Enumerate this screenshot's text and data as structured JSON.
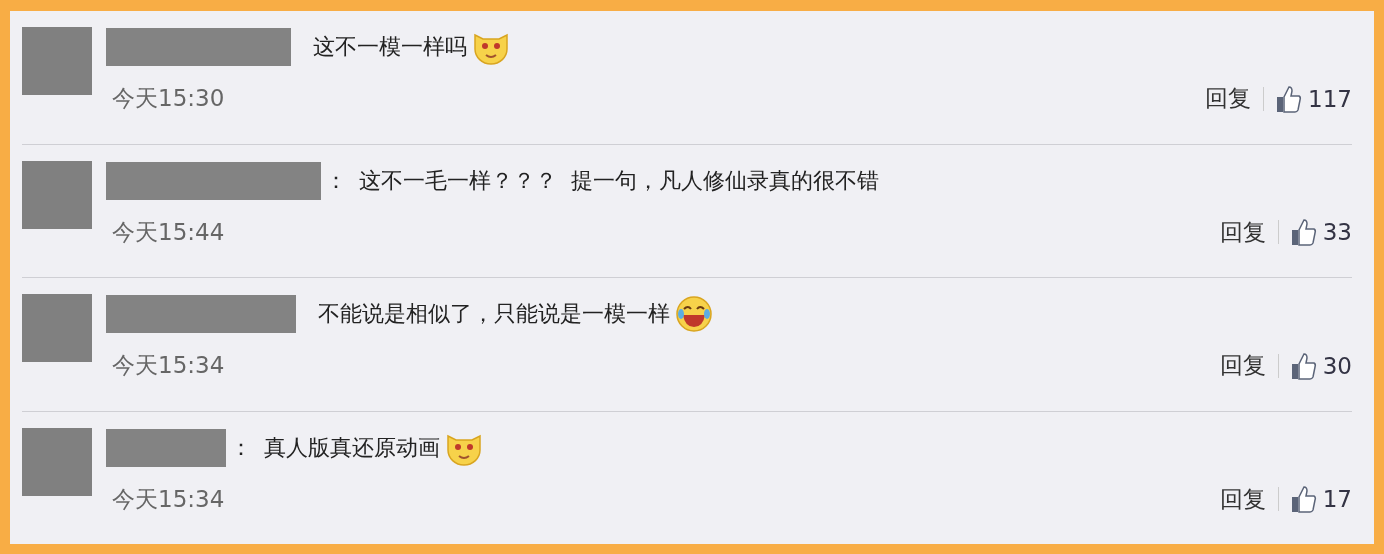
{
  "comments": [
    {
      "text": "这不一模一样吗",
      "emoji": {
        "kind": "dog"
      },
      "time": "今天15:30",
      "reply": "回复",
      "likes": "117"
    },
    {
      "separator": "：",
      "text": "这不一毛一样？？？  提一句，凡人修仙录真的很不错",
      "time": "今天15:44",
      "reply": "回复",
      "likes": "33"
    },
    {
      "text": "不能说是相似了，只能说是一模一样",
      "emoji": {
        "kind": "laugh"
      },
      "time": "今天15:34",
      "reply": "回复",
      "likes": "30"
    },
    {
      "separator": "：",
      "text": "真人版真还原动画",
      "emoji": {
        "kind": "dog"
      },
      "time": "今天15:34",
      "reply": "回复",
      "likes": "17"
    }
  ]
}
